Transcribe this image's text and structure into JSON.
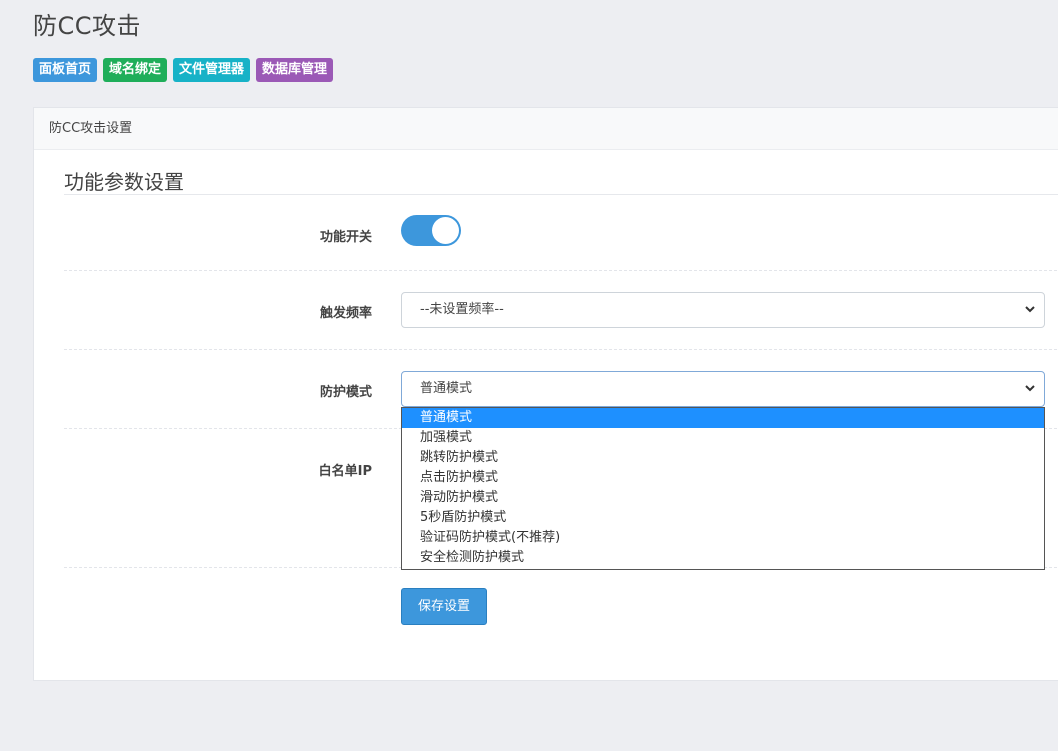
{
  "page_title": "防CC攻击",
  "nav": [
    {
      "label": "面板首页",
      "color": "#3d97dc"
    },
    {
      "label": "域名绑定",
      "color": "#1fae5a"
    },
    {
      "label": "文件管理器",
      "color": "#17b2c7"
    },
    {
      "label": "数据库管理",
      "color": "#9b59b6"
    }
  ],
  "card": {
    "header": "防CC攻击设置",
    "section_title": "功能参数设置",
    "fields": {
      "switch_label": "功能开关",
      "switch_on": true,
      "frequency_label": "触发频率",
      "frequency_value": "--未设置频率--",
      "mode_label": "防护模式",
      "mode_value": "普通模式",
      "whitelist_label": "白名单IP"
    },
    "mode_options": [
      "普通模式",
      "加强模式",
      "跳转防护模式",
      "点击防护模式",
      "滑动防护模式",
      "5秒盾防护模式",
      "验证码防护模式(不推荐)",
      "安全检测防护模式"
    ],
    "selected_option_index": 0,
    "save_label": "保存设置"
  },
  "icons": {
    "select_arrow": "chevron-down-icon"
  },
  "colors": {
    "accent": "#3d97dc",
    "selected_option": "#1e90ff"
  }
}
